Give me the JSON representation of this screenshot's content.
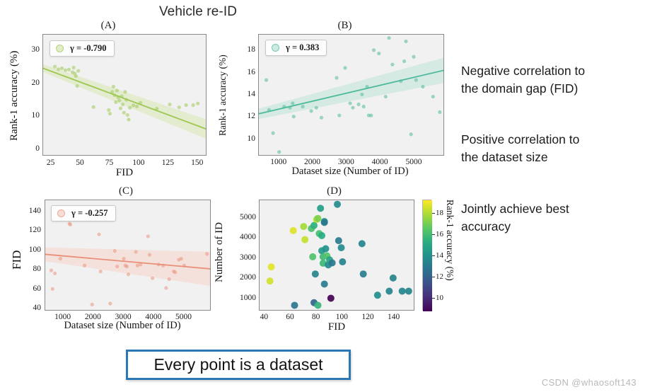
{
  "figure": {
    "title": "Vehicle re-ID",
    "watermark": "CSDN @whaosoft143"
  },
  "callout": {
    "text": "Every point is a dataset"
  },
  "notes": [
    {
      "line1": "Negative correlation to",
      "line2": "the domain gap (FID)"
    },
    {
      "line1": "Positive correlation to",
      "line2": "the dataset size"
    },
    {
      "line1": "Jointly achieve best",
      "line2": "accuracy"
    }
  ],
  "colors": {
    "panel_a": "#9cc751",
    "panel_a_light": "#d9e8b4",
    "panel_b": "#4bb99a",
    "panel_b_light": "#bfe4d9",
    "panel_c": "#ea8f79",
    "panel_c_light": "#f6d3c8",
    "plot_bg": "#f1f1f1",
    "axis": "#8a8a8a",
    "callout_border": "#2b78b5"
  },
  "chart_data": [
    {
      "id": "A",
      "panel_label": "(A)",
      "type": "scatter",
      "title": "Vehicle re-ID",
      "xlabel": "FID",
      "ylabel": "Rank-1 accuracy (%)",
      "legend": "γ = -0.790",
      "correlation": -0.79,
      "xlim": [
        18,
        158
      ],
      "ylim": [
        -2,
        35
      ],
      "xticks": [
        25,
        50,
        75,
        100,
        125,
        150
      ],
      "yticks": [
        0,
        10,
        20,
        30
      ],
      "grid": false,
      "regression": {
        "x": [
          18,
          158
        ],
        "y": [
          24.8,
          6.2
        ],
        "band": 2.2
      },
      "points": [
        [
          28,
          25.3
        ],
        [
          31,
          24.5
        ],
        [
          34,
          24.8
        ],
        [
          37,
          24.2
        ],
        [
          40,
          24.4
        ],
        [
          43,
          23.6
        ],
        [
          44,
          25.0
        ],
        [
          45,
          23.2
        ],
        [
          46,
          22.4
        ],
        [
          47,
          19.4
        ],
        [
          48,
          24.0
        ],
        [
          61,
          13.0
        ],
        [
          74,
          12.1
        ],
        [
          75,
          11.0
        ],
        [
          77,
          17.6
        ],
        [
          78,
          19.2
        ],
        [
          79,
          16.6
        ],
        [
          80,
          14.5
        ],
        [
          81,
          18.0
        ],
        [
          82,
          16.0
        ],
        [
          83,
          15.0
        ],
        [
          84,
          12.6
        ],
        [
          85,
          16.3
        ],
        [
          86,
          13.8
        ],
        [
          87,
          11.3
        ],
        [
          88,
          17.6
        ],
        [
          89,
          15.2
        ],
        [
          90,
          10.6
        ],
        [
          91,
          9.2
        ],
        [
          92,
          12.8
        ],
        [
          95,
          13.5
        ],
        [
          98,
          13.2
        ],
        [
          101,
          14.3
        ],
        [
          115,
          12.5
        ],
        [
          126,
          13.8
        ],
        [
          134,
          12.9
        ],
        [
          140,
          13.6
        ],
        [
          146,
          13.6
        ],
        [
          150,
          14.1
        ]
      ]
    },
    {
      "id": "B",
      "panel_label": "(B)",
      "type": "scatter",
      "xlabel": "Dataset size (Number of ID)",
      "ylabel": "Rank-1 accuracy (%)",
      "legend": "γ = 0.383",
      "correlation": 0.383,
      "xlim": [
        400,
        5900
      ],
      "ylim": [
        8.5,
        19.5
      ],
      "xticks": [
        1000,
        2000,
        3000,
        4000,
        5000
      ],
      "yticks": [
        10,
        12,
        14,
        16,
        18
      ],
      "grid": false,
      "regression": {
        "x": [
          400,
          5900
        ],
        "y": [
          12.35,
          16.3
        ],
        "band": 0.85
      },
      "points": [
        [
          620,
          15.4
        ],
        [
          700,
          12.7
        ],
        [
          820,
          10.6
        ],
        [
          1000,
          8.9
        ],
        [
          1150,
          13.0
        ],
        [
          1320,
          12.9
        ],
        [
          1400,
          13.3
        ],
        [
          1430,
          12.1
        ],
        [
          1700,
          13.0
        ],
        [
          1950,
          12.6
        ],
        [
          2100,
          12.9
        ],
        [
          2250,
          12.0
        ],
        [
          2700,
          15.6
        ],
        [
          2780,
          12.2
        ],
        [
          2950,
          16.5
        ],
        [
          3100,
          13.3
        ],
        [
          3180,
          12.9
        ],
        [
          3350,
          13.2
        ],
        [
          3450,
          14.1
        ],
        [
          3500,
          13.0
        ],
        [
          3600,
          14.8
        ],
        [
          3650,
          12.2
        ],
        [
          3720,
          12.2
        ],
        [
          3800,
          18.1
        ],
        [
          3950,
          17.8
        ],
        [
          4150,
          13.9
        ],
        [
          4250,
          19.2
        ],
        [
          4350,
          16.8
        ],
        [
          4600,
          15.3
        ],
        [
          4700,
          17.1
        ],
        [
          4750,
          18.9
        ],
        [
          4900,
          10.5
        ],
        [
          4980,
          17.5
        ],
        [
          5050,
          15.4
        ],
        [
          5250,
          14.8
        ],
        [
          5550,
          13.9
        ],
        [
          5750,
          12.5
        ]
      ]
    },
    {
      "id": "C",
      "panel_label": "(C)",
      "type": "scatter",
      "xlabel": "Dataset size (Number of ID)",
      "ylabel": "FID",
      "legend": "γ = -0.257",
      "correlation": -0.257,
      "xlim": [
        400,
        5900
      ],
      "ylim": [
        38,
        152
      ],
      "xticks": [
        1000,
        2000,
        3000,
        4000,
        5000
      ],
      "yticks": [
        40,
        60,
        80,
        100,
        120,
        140
      ],
      "grid": false,
      "regression": {
        "x": [
          400,
          5900
        ],
        "y": [
          96.5,
          81.5
        ],
        "band": 13
      },
      "points": [
        [
          600,
          80
        ],
        [
          640,
          61
        ],
        [
          720,
          77
        ],
        [
          900,
          92
        ],
        [
          1200,
          128
        ],
        [
          1230,
          127
        ],
        [
          1700,
          85
        ],
        [
          1950,
          45
        ],
        [
          2180,
          117
        ],
        [
          2230,
          79
        ],
        [
          2550,
          46
        ],
        [
          2700,
          100
        ],
        [
          2780,
          84
        ],
        [
          3000,
          92
        ],
        [
          3050,
          85
        ],
        [
          3100,
          84
        ],
        [
          3150,
          76
        ],
        [
          3400,
          99
        ],
        [
          3450,
          85
        ],
        [
          3550,
          86
        ],
        [
          3800,
          115
        ],
        [
          3850,
          96
        ],
        [
          3950,
          72
        ],
        [
          4150,
          86
        ],
        [
          4300,
          85
        ],
        [
          4400,
          62
        ],
        [
          4500,
          71
        ],
        [
          4650,
          79
        ],
        [
          4700,
          78
        ],
        [
          4820,
          91
        ],
        [
          4900,
          92
        ],
        [
          5000,
          85
        ],
        [
          5750,
          97
        ]
      ]
    },
    {
      "id": "D",
      "panel_label": "(D)",
      "type": "scatter",
      "xlabel": "FID",
      "ylabel": "Number of ID",
      "colorbar_label": "Rank-1 accuracy (%)",
      "colormap": "viridis",
      "xlim": [
        36,
        156
      ],
      "ylim": [
        400,
        5900
      ],
      "xticks": [
        40,
        60,
        80,
        100,
        120,
        140
      ],
      "yticks": [
        1000,
        2000,
        3000,
        4000,
        5000
      ],
      "cticks": [
        10,
        12,
        14,
        16,
        18
      ],
      "clim": [
        8.9,
        19.3
      ],
      "grid": false,
      "points": [
        [
          44,
          1900,
          18.6
        ],
        [
          45,
          2600,
          18.9
        ],
        [
          62,
          4400,
          18.8
        ],
        [
          63,
          700,
          13.0
        ],
        [
          70,
          4600,
          17.9
        ],
        [
          71,
          3950,
          18.4
        ],
        [
          76,
          4500,
          16.3
        ],
        [
          77,
          3100,
          16.4
        ],
        [
          78,
          4650,
          15.6
        ],
        [
          78,
          830,
          12.3
        ],
        [
          79,
          2250,
          13.6
        ],
        [
          80,
          4950,
          18.2
        ],
        [
          81,
          5000,
          17.2
        ],
        [
          81,
          700,
          15.8
        ],
        [
          82,
          4250,
          16.2
        ],
        [
          83,
          5500,
          14.8
        ],
        [
          84,
          4150,
          15.4
        ],
        [
          84,
          3400,
          14.5
        ],
        [
          85,
          3100,
          16.0
        ],
        [
          85,
          2780,
          15.9
        ],
        [
          86,
          4850,
          14.9
        ],
        [
          86,
          4800,
          13.0
        ],
        [
          86,
          1750,
          13.3
        ],
        [
          87,
          3500,
          14.2
        ],
        [
          88,
          3150,
          16.5
        ],
        [
          89,
          2700,
          13.8
        ],
        [
          90,
          2950,
          15.0
        ],
        [
          91,
          1050,
          8.9
        ],
        [
          92,
          2800,
          13.1
        ],
        [
          96,
          5700,
          13.9
        ],
        [
          97,
          3900,
          13.2
        ],
        [
          99,
          3550,
          13.9
        ],
        [
          100,
          2850,
          13.5
        ],
        [
          115,
          3750,
          13.6
        ],
        [
          116,
          2250,
          13.3
        ],
        [
          127,
          1200,
          14.0
        ],
        [
          136,
          1400,
          13.6
        ],
        [
          139,
          2050,
          13.5
        ],
        [
          146,
          1400,
          13.7
        ],
        [
          151,
          1400,
          13.6
        ]
      ]
    }
  ]
}
